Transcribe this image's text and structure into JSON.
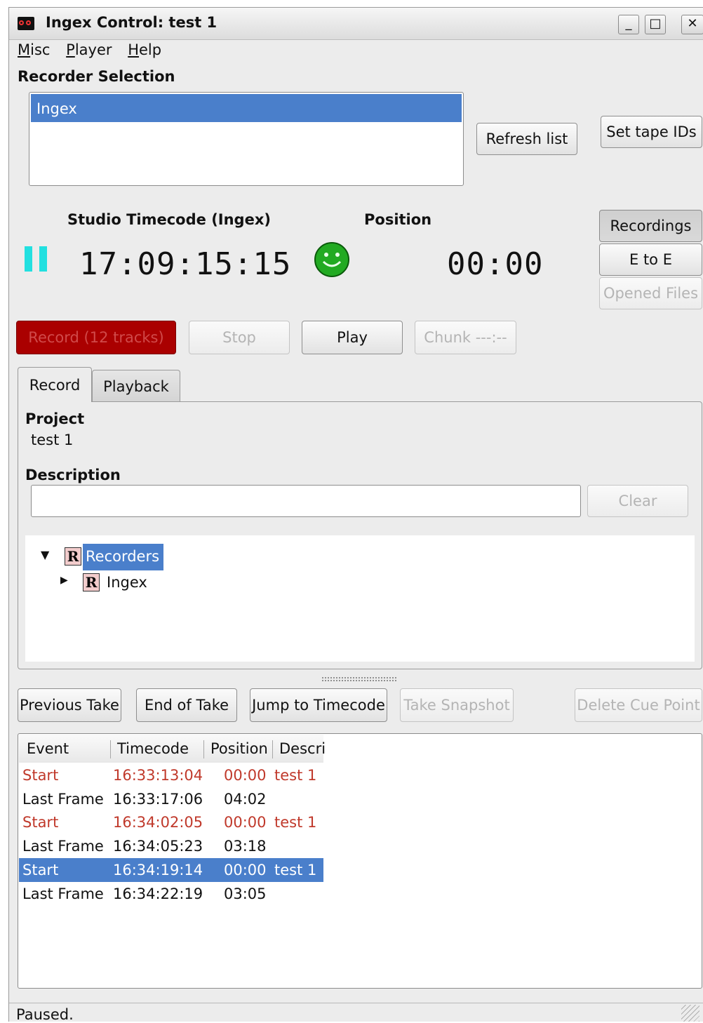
{
  "window": {
    "title": "Ingex Control: test 1",
    "controls": [
      "_",
      "□",
      "✕"
    ]
  },
  "menubar": [
    {
      "underline": "M",
      "rest": "isc"
    },
    {
      "underline": "P",
      "rest": "layer"
    },
    {
      "underline": "H",
      "rest": "elp"
    }
  ],
  "recorder_selection": {
    "label": "Recorder Selection",
    "items": [
      "Ingex"
    ],
    "refresh_label": "Refresh list",
    "set_tape_ids_label": "Set tape IDs"
  },
  "studio_timecode": {
    "label": "Studio Timecode (Ingex)",
    "value": "17:09:15:15"
  },
  "position": {
    "label": "Position",
    "value": "00:00"
  },
  "mode_buttons": {
    "recordings": "Recordings",
    "e_to_e": "E to E",
    "opened_files": "Opened Files"
  },
  "transport": {
    "record": "Record (12 tracks)",
    "stop": "Stop",
    "play": "Play",
    "chunk": "Chunk ---:--"
  },
  "tabs": {
    "record": "Record",
    "playback": "Playback",
    "active": "Record"
  },
  "project": {
    "label": "Project",
    "value": "test 1"
  },
  "description": {
    "label": "Description",
    "value": "",
    "clear_label": "Clear"
  },
  "tree": {
    "root": "Recorders",
    "child": "Ingex",
    "badge": "R"
  },
  "take_buttons": {
    "previous": "Previous Take",
    "end": "End of Take",
    "jump": "Jump to Timecode",
    "snapshot": "Take Snapshot",
    "delete_cue": "Delete Cue Point"
  },
  "events_table": {
    "columns": [
      "Event",
      "Timecode",
      "Position",
      "Descri"
    ],
    "rows": [
      {
        "event": "Start",
        "timecode": "16:33:13:04",
        "position": "00:00",
        "description": "test 1",
        "style": "red"
      },
      {
        "event": "Last Frame",
        "timecode": "16:33:17:06",
        "position": "04:02",
        "description": "",
        "style": "normal"
      },
      {
        "event": "Start",
        "timecode": "16:34:02:05",
        "position": "00:00",
        "description": "test 1",
        "style": "red"
      },
      {
        "event": "Last Frame",
        "timecode": "16:34:05:23",
        "position": "03:18",
        "description": "",
        "style": "normal"
      },
      {
        "event": "Start",
        "timecode": "16:34:19:14",
        "position": "00:00",
        "description": "test 1",
        "style": "selected"
      },
      {
        "event": "Last Frame",
        "timecode": "16:34:22:19",
        "position": "03:05",
        "description": "",
        "style": "normal"
      }
    ]
  },
  "status": {
    "text": "Paused."
  },
  "colors": {
    "selection": "#4a7fcb",
    "record": "#aa0000",
    "pause": "#22e0e0",
    "smiley": "#22aa22",
    "start_text": "#c0392b"
  },
  "icons": {
    "pause": "pause-icon",
    "status": "smiley-icon",
    "app": "tape-icon"
  }
}
